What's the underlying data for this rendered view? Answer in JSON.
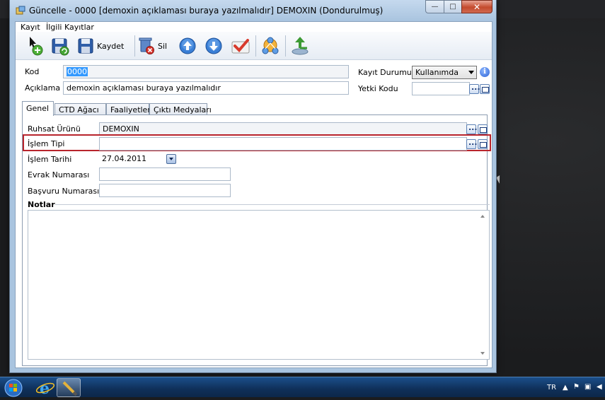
{
  "window": {
    "title": "Güncelle - 0000 [demoxin açıklaması buraya yazılmalıdır] DEMOXIN (Dondurulmuş)",
    "minimize_glyph": "—",
    "maximize_glyph": "□",
    "close_glyph": "✕"
  },
  "menu": {
    "items": [
      {
        "label": "Kayıt"
      },
      {
        "label": "İlgili Kayıtlar"
      }
    ]
  },
  "toolbar": {
    "save_label": "Kaydet",
    "delete_label": "Sil",
    "icons": [
      "new-record-icon",
      "save-refresh-icon",
      "save-icon",
      "delete-icon",
      "up-arrow-icon",
      "down-arrow-icon",
      "check-icon",
      "network-icon",
      "export-icon"
    ]
  },
  "header": {
    "kod_label": "Kod",
    "kod_value": "0000",
    "aciklama_label": "Açıklama",
    "aciklama_value": "demoxin açıklaması buraya yazılmalıdır",
    "kayit_durumu_label": "Kayıt Durumu",
    "kayit_durumu_value": "Kullanımda",
    "yetki_kodu_label": "Yetki Kodu",
    "yetki_kodu_value": ""
  },
  "tabs": [
    {
      "label": "Genel",
      "active": true
    },
    {
      "label": "CTD Ağacı",
      "active": false
    },
    {
      "label": "Faaliyetler",
      "active": false
    },
    {
      "label": "Çıktı Medyaları",
      "active": false
    }
  ],
  "genel": {
    "ruhsat_urunu_label": "Ruhsat Ürünü",
    "ruhsat_urunu_value": "DEMOXIN",
    "islem_tipi_label": "İşlem Tipi",
    "islem_tipi_value": "",
    "islem_tarihi_label": "İşlem Tarihi",
    "islem_tarihi_value": "27.04.2011",
    "evrak_numarasi_label": "Evrak Numarası",
    "evrak_numarasi_value": "",
    "basvuru_numarasi_label": "Başvuru Numarası",
    "basvuru_numarasi_value": "",
    "notlar_label": "Notlar",
    "notlar_value": ""
  },
  "taskbar": {
    "language": "TR"
  },
  "colors": {
    "highlight_border": "#b8242c",
    "selection": "#3399ff",
    "window_frame": "#a9c4df",
    "taskbar": "#0f2f58"
  }
}
